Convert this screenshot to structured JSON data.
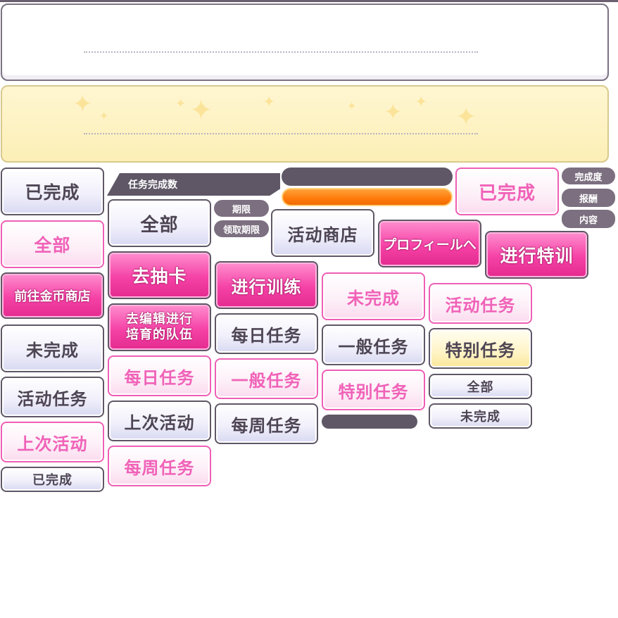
{
  "buttons": {
    "completed": "已完成",
    "all": "全部",
    "go_coin_shop": "前往金币商店",
    "incomplete": "未完成",
    "event_missions": "活动任务",
    "last_event": "上次活动",
    "task_completion_count": "任务完成数",
    "go_gacha": "去抽卡",
    "edit_team": [
      "去编辑进行",
      "培育的队伍"
    ],
    "daily_missions": "每日任务",
    "weekly_missions": "每周任务",
    "period": "期限",
    "claim_period": "领取期限",
    "do_training": "进行训练",
    "event_shop": "活动商店",
    "normal_missions": "一般任务",
    "to_profile": "プロフィールへ",
    "special_missions": "特别任务",
    "special_training": "进行特训",
    "completion_rate": "完成度",
    "reward": "报酬",
    "content": "内容"
  },
  "colors": {
    "pink_text": "#f062b8",
    "magenta_fill": "#f542a6",
    "dark_outline": "#5f5766",
    "orange_bar": "#ff7a0a",
    "gold_panel": "#fcefb6"
  }
}
